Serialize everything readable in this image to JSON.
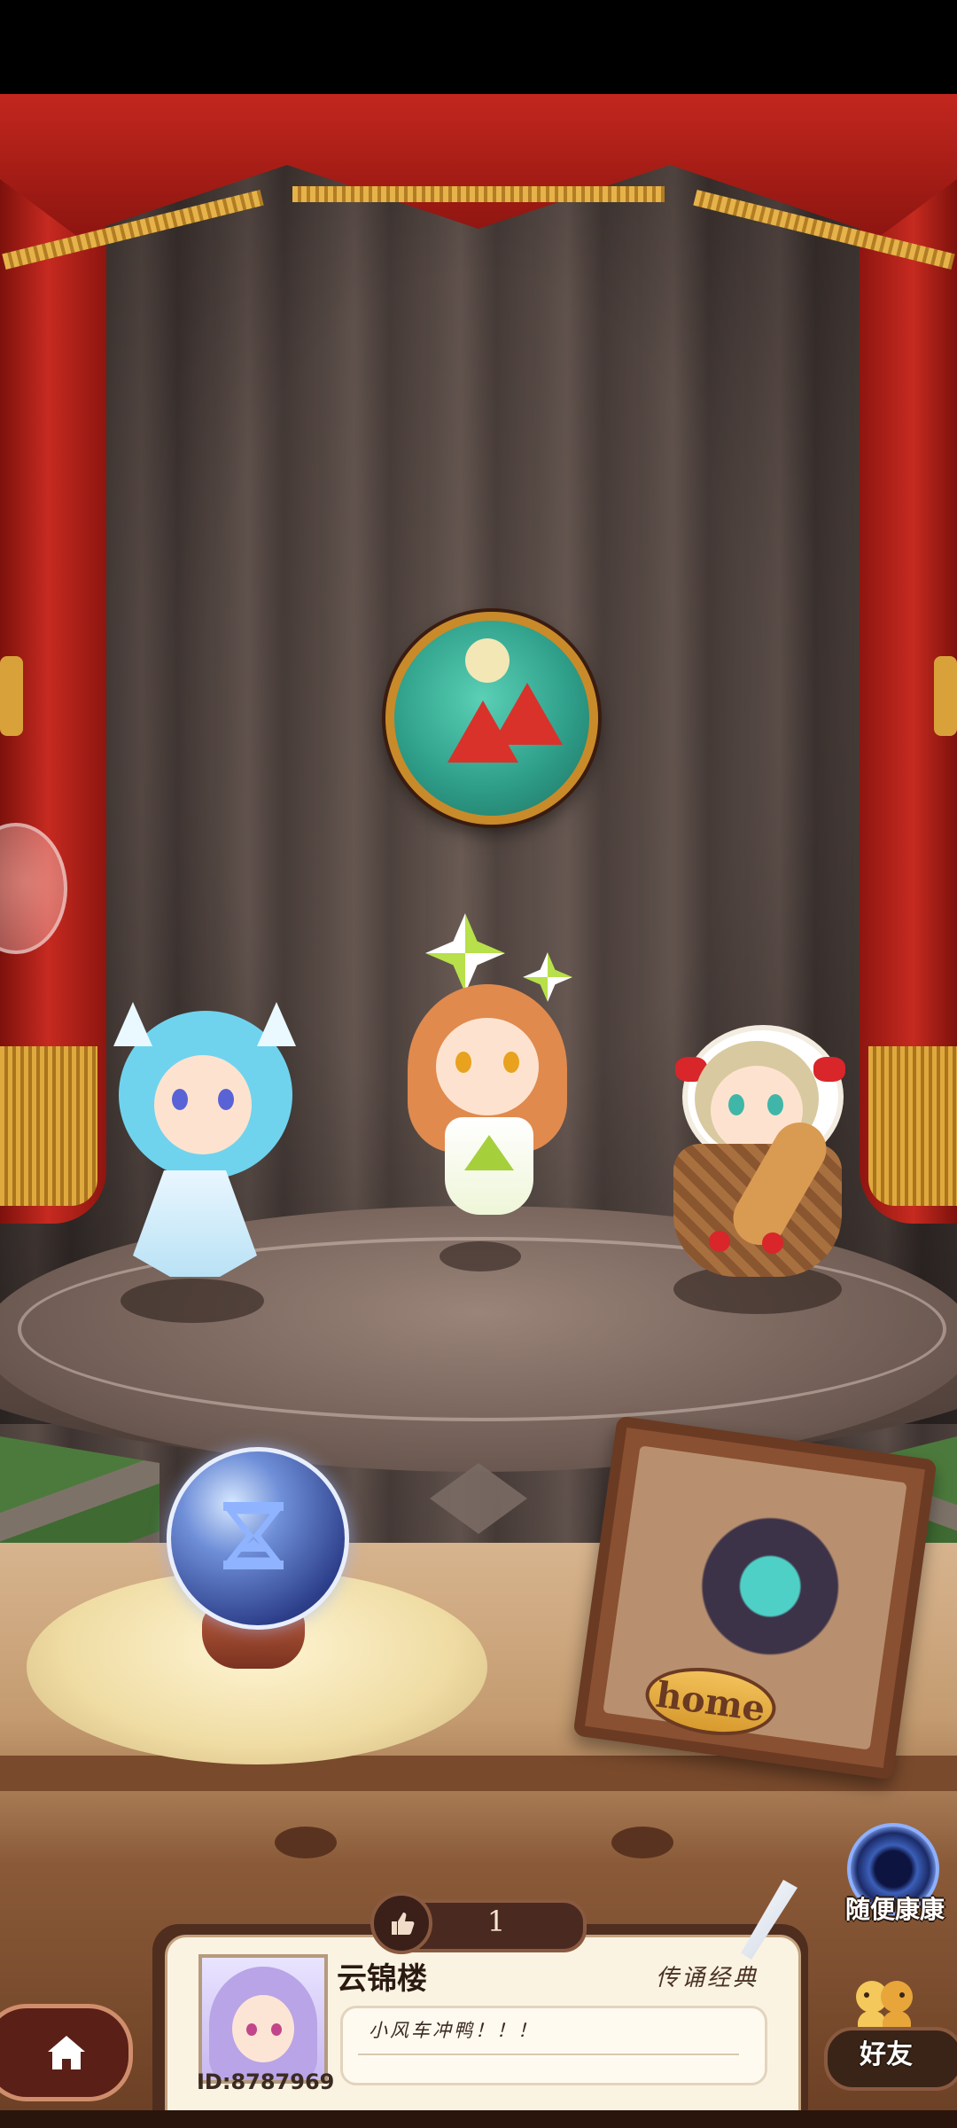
{
  "stage": {
    "emblem_icon": "watermelon-island-emblem-icon",
    "characters": [
      {
        "name": "ice-cat-girl",
        "hair_color": "#6fd3ee"
      },
      {
        "name": "pinwheel-girl",
        "hair_color": "#e08a4e"
      },
      {
        "name": "bread-basket-girl",
        "hair_color": "#d8c9a0"
      }
    ]
  },
  "left_floating": {
    "icon": "floating-bubble-icon"
  },
  "crystal_ball": {
    "icon": "hourglass-icon"
  },
  "home_frame": {
    "label": "home"
  },
  "random_visit": {
    "label": "随便康康",
    "icon": "portal-icon"
  },
  "profile": {
    "likes": "1",
    "like_icon": "thumbs-up-icon",
    "name": "云锦楼",
    "title": "传诵经典",
    "id": "ID:8787969",
    "message": "小风车冲鸭！！！"
  },
  "nav": {
    "home_icon": "home-icon",
    "friends_label": "好友",
    "friends_icon": "friends-icon"
  },
  "colors": {
    "curtain": "#c2271e",
    "gold": "#e6b24a",
    "card_bg": "#fbf3e2",
    "dark_brown": "#4f2e20"
  }
}
